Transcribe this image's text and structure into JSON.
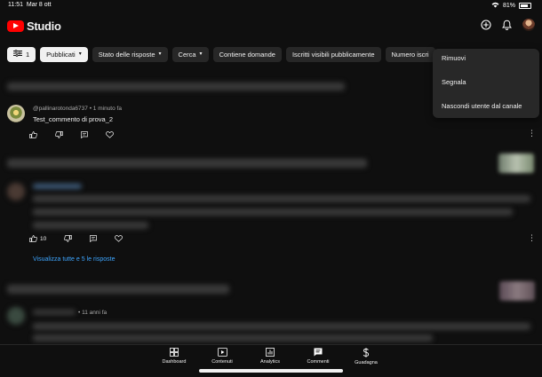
{
  "status_bar": {
    "time": "11:51",
    "date": "Mar 8 ott",
    "battery": "81%"
  },
  "header": {
    "app_name": "Studio"
  },
  "filters": {
    "filter_count": "1",
    "chips": [
      "Pubblicati",
      "Stato delle risposte",
      "Cerca",
      "Contiene domande",
      "Iscritti visibili pubblicamente",
      "Numero iscri"
    ]
  },
  "comment": {
    "author": "@pallinarotonda6737",
    "time": "1 minuto fa",
    "text": "Test_commento di prova_2"
  },
  "second_comment": {
    "likes": "10",
    "replies_link": "Visualizza tutte e 5 le risposte"
  },
  "third_comment": {
    "time": "• 11 anni fa"
  },
  "context_menu": {
    "items": [
      "Rimuovi",
      "Segnala",
      "Nascondi utente dal canale"
    ]
  },
  "bottom_nav": {
    "items": [
      "Dashboard",
      "Contenuti",
      "Analytics",
      "Commenti",
      "Guadagna"
    ],
    "active": "Commenti"
  },
  "colors": {
    "background": "#0f0f0f",
    "link": "#3ea6ff",
    "brand_red": "#ff0000"
  }
}
